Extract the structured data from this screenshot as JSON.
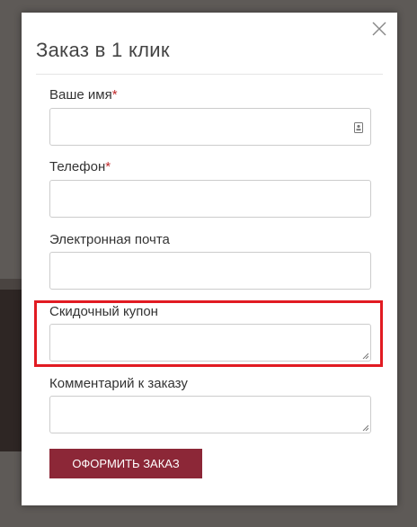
{
  "modal": {
    "title": "Заказ в 1 клик",
    "close_icon": "close-icon"
  },
  "form": {
    "fields": [
      {
        "label": "Ваше имя",
        "required_mark": "*",
        "value": "",
        "icon": "contact-card-icon"
      },
      {
        "label": "Телефон",
        "required_mark": "*",
        "value": ""
      },
      {
        "label": "Электронная почта",
        "value": ""
      },
      {
        "label": "Скидочный купон",
        "value": ""
      },
      {
        "label": "Комментарий к заказу",
        "value": ""
      }
    ],
    "submit_label": "ОФОРМИТЬ ЗАКАЗ"
  },
  "colors": {
    "required": "#c0292b",
    "button": "#8c2737",
    "highlight": "#e11b22",
    "overlay": "#5e5a57"
  }
}
